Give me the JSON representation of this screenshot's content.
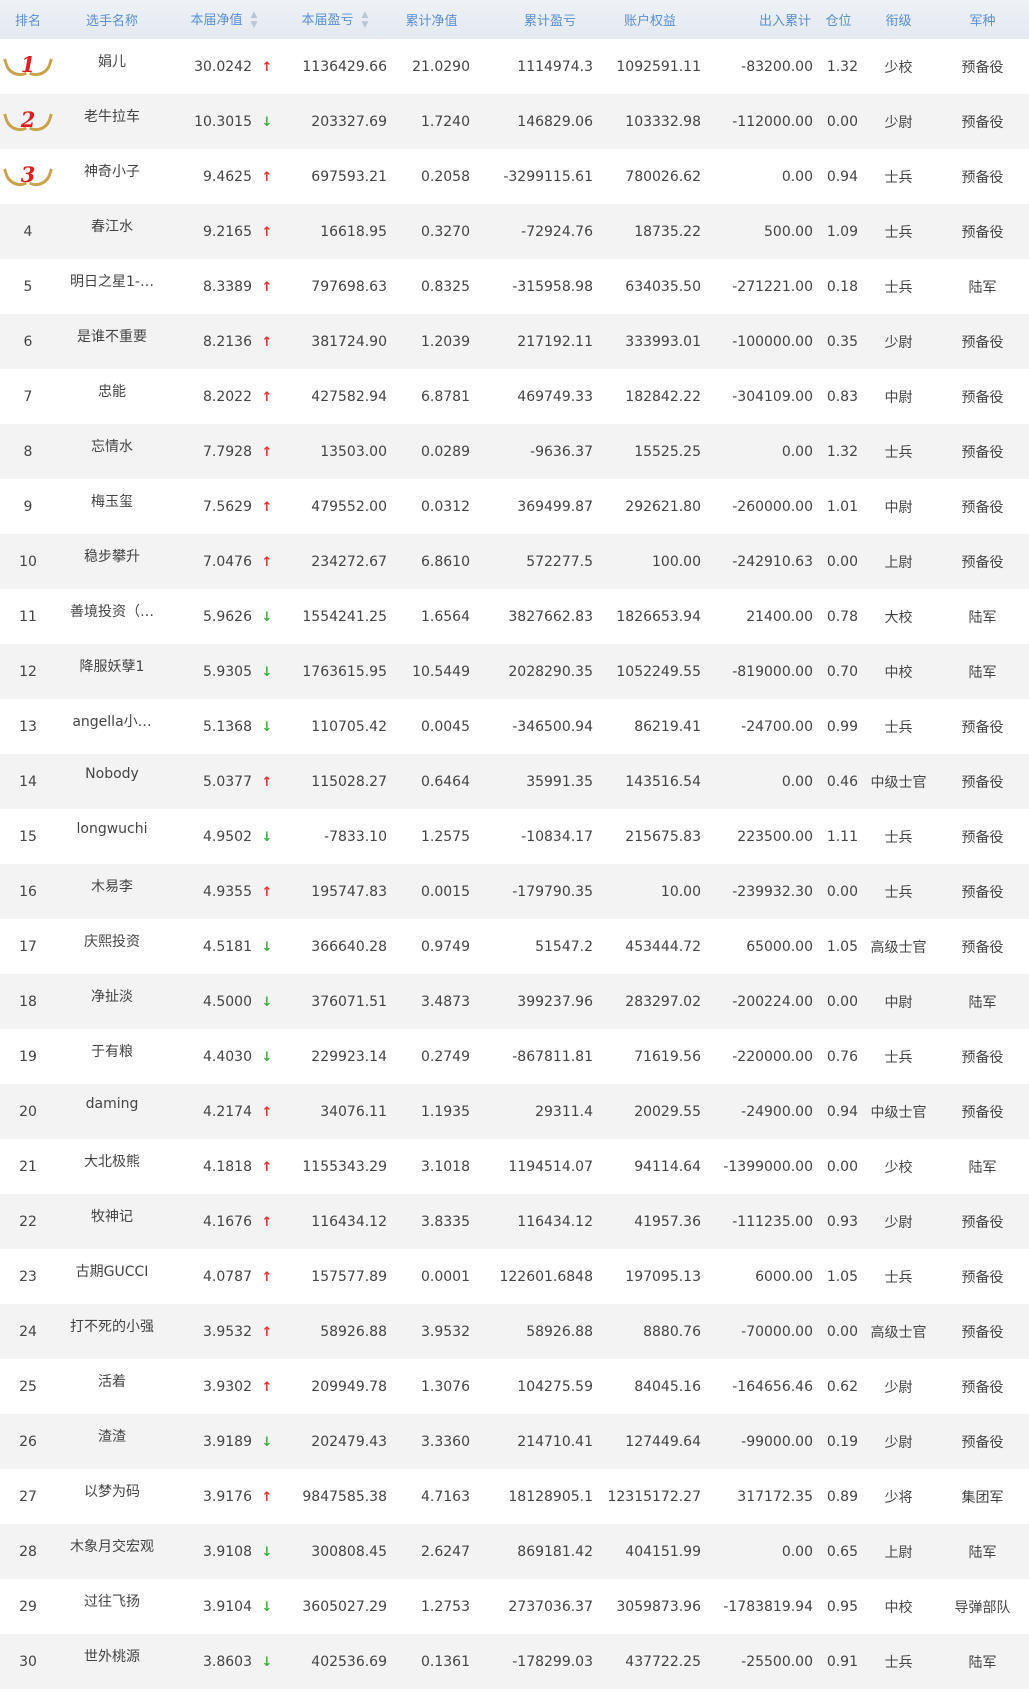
{
  "headers": {
    "rank": "排名",
    "name": "选手名称",
    "nav": "本届净值",
    "pnl": "本届盈亏",
    "cum_nav": "累计净值",
    "cum_pnl": "累计盈亏",
    "equity": "账户权益",
    "flow": "出入累计",
    "position": "仓位",
    "title": "衔级",
    "branch": "军种"
  },
  "colors": {
    "header_text": "#5a8ed4",
    "up": "#e23030",
    "down": "#3daf3d",
    "medal": "#c9a24b"
  },
  "rows": [
    {
      "rank": "1",
      "medal": true,
      "name": "娟儿",
      "nav": "30.0242",
      "trend": "up",
      "pnl": "1136429.66",
      "cum_nav": "21.0290",
      "cum_pnl": "1114974.3",
      "equity": "1092591.11",
      "flow": "-83200.00",
      "position": "1.32",
      "title": "少校",
      "branch": "预备役"
    },
    {
      "rank": "2",
      "medal": true,
      "name": "老牛拉车",
      "nav": "10.3015",
      "trend": "down",
      "pnl": "203327.69",
      "cum_nav": "1.7240",
      "cum_pnl": "146829.06",
      "equity": "103332.98",
      "flow": "-112000.00",
      "position": "0.00",
      "title": "少尉",
      "branch": "预备役"
    },
    {
      "rank": "3",
      "medal": true,
      "name": "神奇小子",
      "nav": "9.4625",
      "trend": "up",
      "pnl": "697593.21",
      "cum_nav": "0.2058",
      "cum_pnl": "-3299115.61",
      "equity": "780026.62",
      "flow": "0.00",
      "position": "0.94",
      "title": "士兵",
      "branch": "预备役"
    },
    {
      "rank": "4",
      "medal": false,
      "name": "春江水",
      "nav": "9.2165",
      "trend": "up",
      "pnl": "16618.95",
      "cum_nav": "0.3270",
      "cum_pnl": "-72924.76",
      "equity": "18735.22",
      "flow": "500.00",
      "position": "1.09",
      "title": "士兵",
      "branch": "预备役"
    },
    {
      "rank": "5",
      "medal": false,
      "name": "明日之星1-…",
      "nav": "8.3389",
      "trend": "up",
      "pnl": "797698.63",
      "cum_nav": "0.8325",
      "cum_pnl": "-315958.98",
      "equity": "634035.50",
      "flow": "-271221.00",
      "position": "0.18",
      "title": "士兵",
      "branch": "陆军"
    },
    {
      "rank": "6",
      "medal": false,
      "name": "是谁不重要",
      "nav": "8.2136",
      "trend": "up",
      "pnl": "381724.90",
      "cum_nav": "1.2039",
      "cum_pnl": "217192.11",
      "equity": "333993.01",
      "flow": "-100000.00",
      "position": "0.35",
      "title": "少尉",
      "branch": "预备役"
    },
    {
      "rank": "7",
      "medal": false,
      "name": "忠能",
      "nav": "8.2022",
      "trend": "up",
      "pnl": "427582.94",
      "cum_nav": "6.8781",
      "cum_pnl": "469749.33",
      "equity": "182842.22",
      "flow": "-304109.00",
      "position": "0.83",
      "title": "中尉",
      "branch": "预备役"
    },
    {
      "rank": "8",
      "medal": false,
      "name": "忘情水",
      "nav": "7.7928",
      "trend": "up",
      "pnl": "13503.00",
      "cum_nav": "0.0289",
      "cum_pnl": "-9636.37",
      "equity": "15525.25",
      "flow": "0.00",
      "position": "1.32",
      "title": "士兵",
      "branch": "预备役"
    },
    {
      "rank": "9",
      "medal": false,
      "name": "梅玉玺",
      "nav": "7.5629",
      "trend": "up",
      "pnl": "479552.00",
      "cum_nav": "0.0312",
      "cum_pnl": "369499.87",
      "equity": "292621.80",
      "flow": "-260000.00",
      "position": "1.01",
      "title": "中尉",
      "branch": "预备役"
    },
    {
      "rank": "10",
      "medal": false,
      "name": "稳步攀升",
      "nav": "7.0476",
      "trend": "up",
      "pnl": "234272.67",
      "cum_nav": "6.8610",
      "cum_pnl": "572277.5",
      "equity": "100.00",
      "flow": "-242910.63",
      "position": "0.00",
      "title": "上尉",
      "branch": "预备役"
    },
    {
      "rank": "11",
      "medal": false,
      "name": "善境投资（…",
      "nav": "5.9626",
      "trend": "down",
      "pnl": "1554241.25",
      "cum_nav": "1.6564",
      "cum_pnl": "3827662.83",
      "equity": "1826653.94",
      "flow": "21400.00",
      "position": "0.78",
      "title": "大校",
      "branch": "陆军"
    },
    {
      "rank": "12",
      "medal": false,
      "name": "降服妖孽1",
      "nav": "5.9305",
      "trend": "down",
      "pnl": "1763615.95",
      "cum_nav": "10.5449",
      "cum_pnl": "2028290.35",
      "equity": "1052249.55",
      "flow": "-819000.00",
      "position": "0.70",
      "title": "中校",
      "branch": "陆军"
    },
    {
      "rank": "13",
      "medal": false,
      "name": "angella小…",
      "nav": "5.1368",
      "trend": "down",
      "pnl": "110705.42",
      "cum_nav": "0.0045",
      "cum_pnl": "-346500.94",
      "equity": "86219.41",
      "flow": "-24700.00",
      "position": "0.99",
      "title": "士兵",
      "branch": "预备役"
    },
    {
      "rank": "14",
      "medal": false,
      "name": "Nobody",
      "nav": "5.0377",
      "trend": "up",
      "pnl": "115028.27",
      "cum_nav": "0.6464",
      "cum_pnl": "35991.35",
      "equity": "143516.54",
      "flow": "0.00",
      "position": "0.46",
      "title": "中级士官",
      "branch": "预备役"
    },
    {
      "rank": "15",
      "medal": false,
      "name": "longwuchi",
      "nav": "4.9502",
      "trend": "down",
      "pnl": "-7833.10",
      "cum_nav": "1.2575",
      "cum_pnl": "-10834.17",
      "equity": "215675.83",
      "flow": "223500.00",
      "position": "1.11",
      "title": "士兵",
      "branch": "预备役"
    },
    {
      "rank": "16",
      "medal": false,
      "name": "木易李",
      "nav": "4.9355",
      "trend": "up",
      "pnl": "195747.83",
      "cum_nav": "0.0015",
      "cum_pnl": "-179790.35",
      "equity": "10.00",
      "flow": "-239932.30",
      "position": "0.00",
      "title": "士兵",
      "branch": "预备役"
    },
    {
      "rank": "17",
      "medal": false,
      "name": "庆熙投资",
      "nav": "4.5181",
      "trend": "down",
      "pnl": "366640.28",
      "cum_nav": "0.9749",
      "cum_pnl": "51547.2",
      "equity": "453444.72",
      "flow": "65000.00",
      "position": "1.05",
      "title": "高级士官",
      "branch": "预备役"
    },
    {
      "rank": "18",
      "medal": false,
      "name": "净扯淡",
      "nav": "4.5000",
      "trend": "down",
      "pnl": "376071.51",
      "cum_nav": "3.4873",
      "cum_pnl": "399237.96",
      "equity": "283297.02",
      "flow": "-200224.00",
      "position": "0.00",
      "title": "中尉",
      "branch": "陆军"
    },
    {
      "rank": "19",
      "medal": false,
      "name": "于有粮",
      "nav": "4.4030",
      "trend": "down",
      "pnl": "229923.14",
      "cum_nav": "0.2749",
      "cum_pnl": "-867811.81",
      "equity": "71619.56",
      "flow": "-220000.00",
      "position": "0.76",
      "title": "士兵",
      "branch": "预备役"
    },
    {
      "rank": "20",
      "medal": false,
      "name": "daming",
      "nav": "4.2174",
      "trend": "up",
      "pnl": "34076.11",
      "cum_nav": "1.1935",
      "cum_pnl": "29311.4",
      "equity": "20029.55",
      "flow": "-24900.00",
      "position": "0.94",
      "title": "中级士官",
      "branch": "预备役"
    },
    {
      "rank": "21",
      "medal": false,
      "name": "大北极熊",
      "nav": "4.1818",
      "trend": "up",
      "pnl": "1155343.29",
      "cum_nav": "3.1018",
      "cum_pnl": "1194514.07",
      "equity": "94114.64",
      "flow": "-1399000.00",
      "position": "0.00",
      "title": "少校",
      "branch": "陆军"
    },
    {
      "rank": "22",
      "medal": false,
      "name": "牧神记",
      "nav": "4.1676",
      "trend": "up",
      "pnl": "116434.12",
      "cum_nav": "3.8335",
      "cum_pnl": "116434.12",
      "equity": "41957.36",
      "flow": "-111235.00",
      "position": "0.93",
      "title": "少尉",
      "branch": "预备役"
    },
    {
      "rank": "23",
      "medal": false,
      "name": "古期GUCCI",
      "nav": "4.0787",
      "trend": "up",
      "pnl": "157577.89",
      "cum_nav": "0.0001",
      "cum_pnl": "122601.6848",
      "equity": "197095.13",
      "flow": "6000.00",
      "position": "1.05",
      "title": "士兵",
      "branch": "预备役"
    },
    {
      "rank": "24",
      "medal": false,
      "name": "打不死的小强",
      "nav": "3.9532",
      "trend": "up",
      "pnl": "58926.88",
      "cum_nav": "3.9532",
      "cum_pnl": "58926.88",
      "equity": "8880.76",
      "flow": "-70000.00",
      "position": "0.00",
      "title": "高级士官",
      "branch": "预备役"
    },
    {
      "rank": "25",
      "medal": false,
      "name": "活着",
      "nav": "3.9302",
      "trend": "up",
      "pnl": "209949.78",
      "cum_nav": "1.3076",
      "cum_pnl": "104275.59",
      "equity": "84045.16",
      "flow": "-164656.46",
      "position": "0.62",
      "title": "少尉",
      "branch": "预备役"
    },
    {
      "rank": "26",
      "medal": false,
      "name": "渣渣",
      "nav": "3.9189",
      "trend": "down",
      "pnl": "202479.43",
      "cum_nav": "3.3360",
      "cum_pnl": "214710.41",
      "equity": "127449.64",
      "flow": "-99000.00",
      "position": "0.19",
      "title": "少尉",
      "branch": "预备役"
    },
    {
      "rank": "27",
      "medal": false,
      "name": "以梦为码",
      "nav": "3.9176",
      "trend": "up",
      "pnl": "9847585.38",
      "cum_nav": "4.7163",
      "cum_pnl": "18128905.1",
      "equity": "12315172.27",
      "flow": "317172.35",
      "position": "0.89",
      "title": "少将",
      "branch": "集团军"
    },
    {
      "rank": "28",
      "medal": false,
      "name": "木象月交宏观",
      "nav": "3.9108",
      "trend": "down",
      "pnl": "300808.45",
      "cum_nav": "2.6247",
      "cum_pnl": "869181.42",
      "equity": "404151.99",
      "flow": "0.00",
      "position": "0.65",
      "title": "上尉",
      "branch": "陆军"
    },
    {
      "rank": "29",
      "medal": false,
      "name": "过往飞扬",
      "nav": "3.9104",
      "trend": "down",
      "pnl": "3605027.29",
      "cum_nav": "1.2753",
      "cum_pnl": "2737036.37",
      "equity": "3059873.96",
      "flow": "-1783819.94",
      "position": "0.95",
      "title": "中校",
      "branch": "导弹部队"
    },
    {
      "rank": "30",
      "medal": false,
      "name": "世外桃源",
      "nav": "3.8603",
      "trend": "down",
      "pnl": "402536.69",
      "cum_nav": "0.1361",
      "cum_pnl": "-178299.03",
      "equity": "437722.25",
      "flow": "-25500.00",
      "position": "0.91",
      "title": "士兵",
      "branch": "陆军"
    }
  ]
}
